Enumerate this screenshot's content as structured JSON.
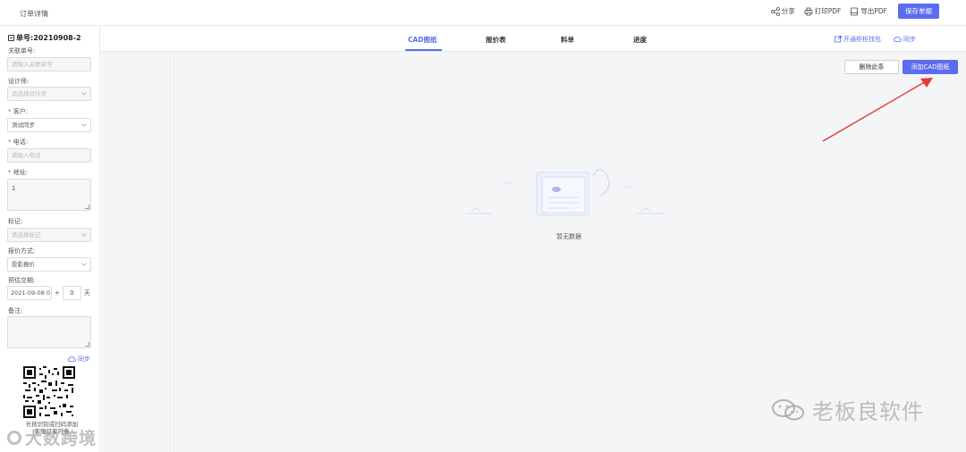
{
  "header": {
    "title": "订单详情",
    "share_label": "分享",
    "print_label": "打印PDF",
    "export_label": "导出PDF",
    "save_label": "保存单据"
  },
  "order": {
    "number_label": "单号:20210908-2"
  },
  "fields": {
    "related": {
      "label": "关联单号:",
      "placeholder": "请输入关联单号"
    },
    "designer": {
      "label": "设计师:",
      "placeholder": "请选择设计师"
    },
    "customer": {
      "label": "客户:",
      "value": "测试同步"
    },
    "phone": {
      "label": "电话:",
      "placeholder": "请输入电话"
    },
    "address": {
      "label": "地址:",
      "value": "1"
    },
    "mark": {
      "label": "标记:",
      "placeholder": "请选择标记"
    },
    "quote": {
      "label": "报价方式:",
      "value": "投影报价"
    },
    "delivery": {
      "label": "预估交期:",
      "date": "2021-09-08 0",
      "plus": "+",
      "days": "0",
      "unit": "天"
    },
    "remark": {
      "label": "备注:"
    }
  },
  "left_sync_label": "同步",
  "qr_caption": "长按识别或扫码添加\n客服订单可查",
  "tabs": [
    {
      "label": "CAD图纸"
    },
    {
      "label": "报价表"
    },
    {
      "label": "料单"
    },
    {
      "label": "进度"
    }
  ],
  "tab_actions": {
    "cabinet": "开通柜柜找包",
    "sync": "同步"
  },
  "main": {
    "delete_label": "删除此条",
    "add_label": "添加CAD图纸",
    "empty_text": "暂无数据"
  },
  "watermarks": {
    "left": "大数跨境",
    "right": "老板良软件"
  },
  "colors": {
    "accent": "#5b6cf0",
    "required": "#e54545",
    "arrow": "#e53935"
  }
}
